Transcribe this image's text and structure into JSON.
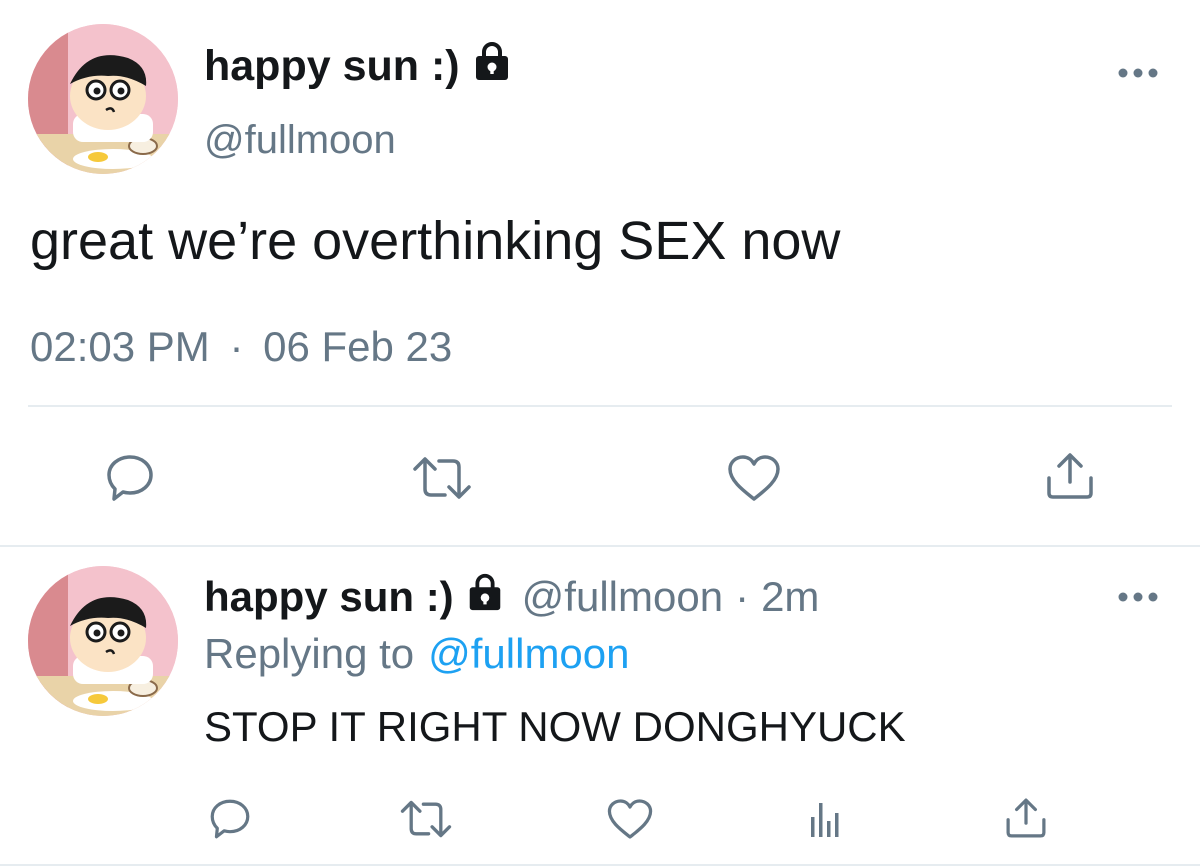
{
  "main_tweet": {
    "display_name": "happy sun :)",
    "handle": "@fullmoon",
    "text": "great we’re overthinking SEX now",
    "time": "02:03 PM",
    "separator": "·",
    "date": "06 Feb 23"
  },
  "reply": {
    "display_name": "happy sun :)",
    "handle": "@fullmoon",
    "separator": "·",
    "time_ago": "2m",
    "replying_to_label": "Replying to",
    "replying_to_handle": "@fullmoon",
    "text": "STOP IT RIGHT NOW DONGHYUCK"
  },
  "icons": {
    "lock": "lock-icon",
    "more": "more-dots-icon",
    "reply": "reply-bubble-icon",
    "retweet": "retweet-icon",
    "like": "heart-icon",
    "analytics": "analytics-bars-icon",
    "share": "share-upload-icon"
  },
  "colors": {
    "text": "#14171a",
    "secondary": "#657786",
    "link": "#1da1f2",
    "divider": "#e6ecf0"
  }
}
